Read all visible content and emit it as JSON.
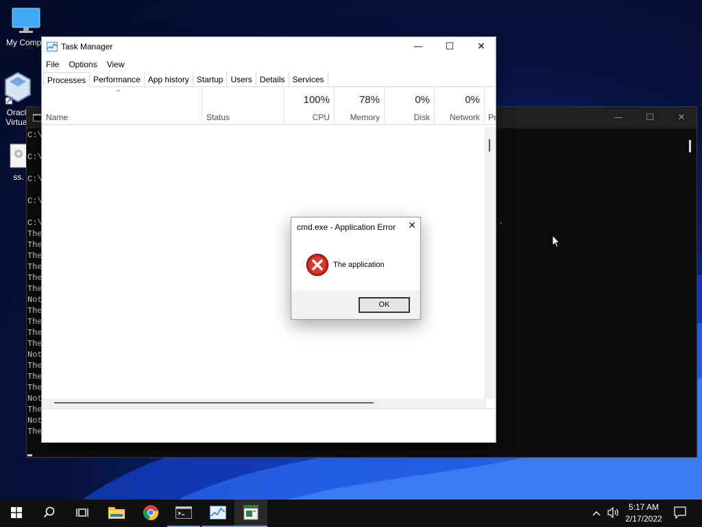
{
  "desktop": {
    "icons": [
      {
        "label": "My Compu",
        "icon": "monitor-icon"
      },
      {
        "label1": "Oracl",
        "label2": "Virtua",
        "icon": "virtualbox-icon"
      },
      {
        "label": "ss.",
        "icon": "settings-file-icon"
      }
    ]
  },
  "cmd": {
    "title_icon": "cmd-icon",
    "lines": [
      "C:\\",
      "",
      "C:\\",
      "",
      "C:\\",
      "",
      "C:\\",
      "",
      "C:\\",
      "The",
      "The",
      "The",
      "The",
      "The",
      "The",
      "Not",
      "The",
      "The",
      "The",
      "The",
      "Not",
      "The",
      "The",
      "The",
      "Not",
      "The",
      "Not",
      "The system cannot execute the specified program."
    ],
    "right_fragment": "."
  },
  "task_manager": {
    "title": "Task Manager",
    "menu": [
      "File",
      "Options",
      "View"
    ],
    "tabs": [
      "Processes",
      "Performance",
      "App history",
      "Startup",
      "Users",
      "Details",
      "Services"
    ],
    "active_tab": "Processes",
    "columns": {
      "name": "Name",
      "status": "Status",
      "cpu": {
        "pct": "100%",
        "label": "CPU"
      },
      "memory": {
        "pct": "78%",
        "label": "Memory"
      },
      "disk": {
        "pct": "0%",
        "label": "Disk"
      },
      "network": {
        "pct": "0%",
        "label": "Network"
      },
      "power": "Po"
    }
  },
  "dialog": {
    "title": "cmd.exe - Application Error",
    "message": "The application",
    "ok": "OK",
    "icon": "error-icon"
  },
  "taskbar": {
    "items": [
      "start-icon",
      "search-icon",
      "task-view-icon",
      "file-explorer-icon",
      "chrome-icon",
      "cmd-taskbar-icon",
      "task-manager-taskbar-icon",
      "error-app-taskbar-icon"
    ],
    "time": "5:17 AM",
    "date": "2/17/2022"
  },
  "colors": {
    "accent": "#8f8fd8",
    "error_red": "#c42b1c",
    "taskbar": "#101010"
  }
}
